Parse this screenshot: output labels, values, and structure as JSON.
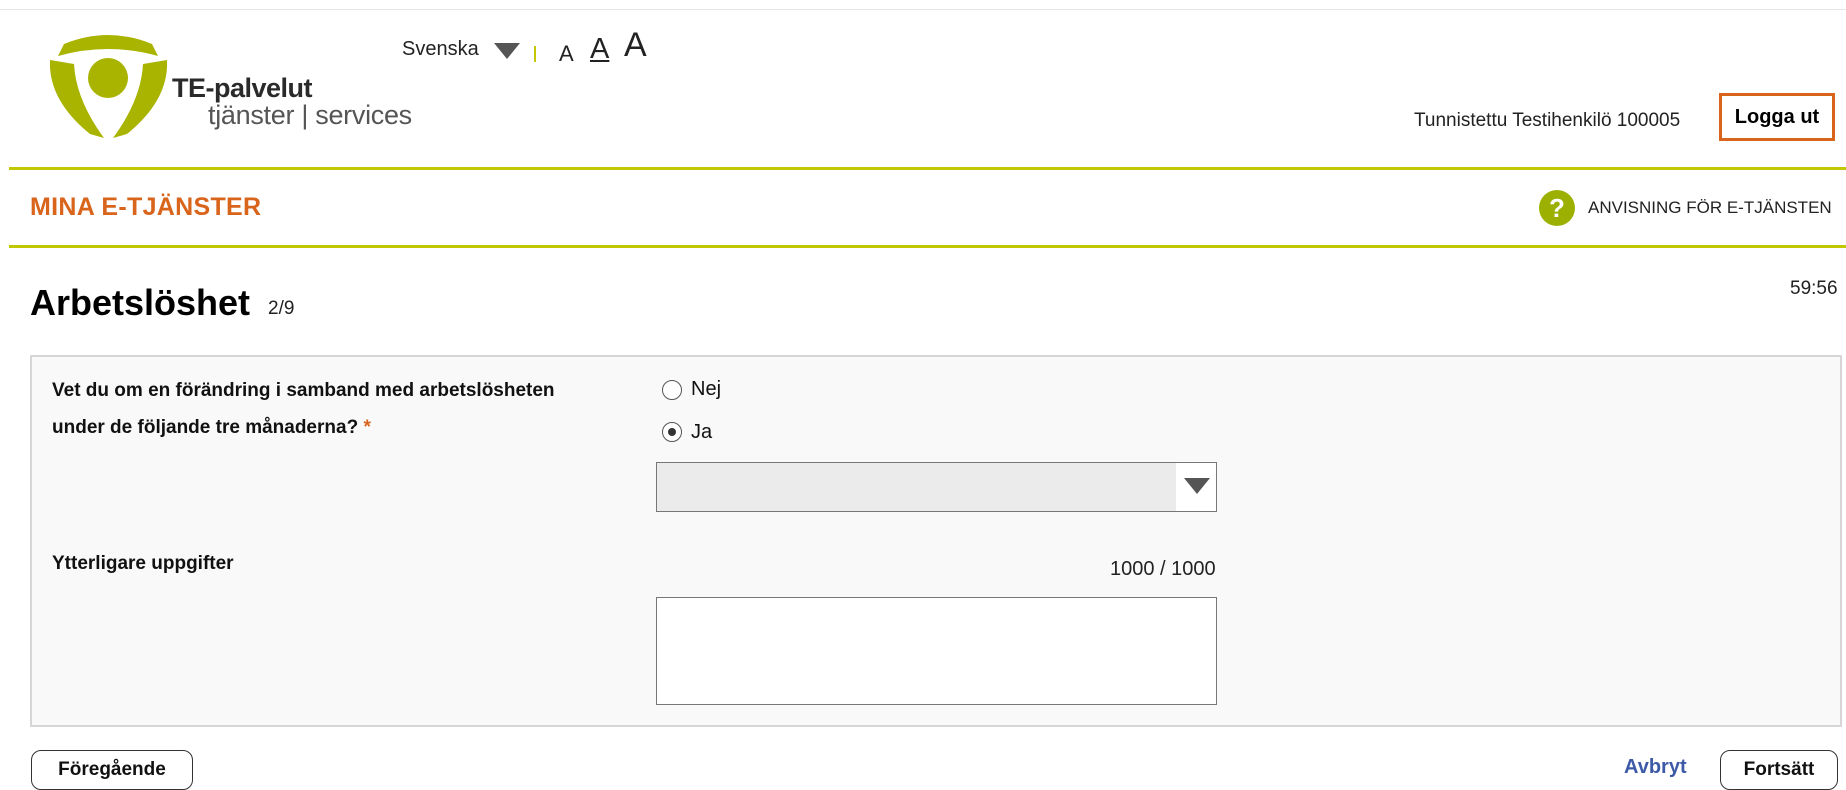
{
  "header": {
    "logo": {
      "name": "TE-palvelut",
      "tagline": "tjänster | services"
    },
    "language": {
      "selected": "Svenska"
    },
    "text_size": {
      "small": "A",
      "medium": "A",
      "large": "A"
    },
    "user": {
      "name": "Tunnistettu Testihenkilö 100005"
    },
    "logout_label": "Logga ut"
  },
  "service_bar": {
    "title": "MINA E-TJÄNSTER",
    "help_icon": "?",
    "help_link": "ANVISNING FÖR E-TJÄNSTEN"
  },
  "page": {
    "title": "Arbetslöshet",
    "step": "2/9",
    "timer": "59:56"
  },
  "form": {
    "question": {
      "label": "Vet du om en förändring i samband med arbetslösheten under de följande tre månaderna?",
      "required_mark": "*",
      "options": [
        {
          "label": "Nej",
          "selected": false
        },
        {
          "label": "Ja",
          "selected": true
        }
      ],
      "select_value": ""
    },
    "extra": {
      "label": "Ytterligare uppgifter",
      "counter": "1000 / 1000",
      "value": ""
    }
  },
  "footer": {
    "prev_label": "Föregående",
    "cancel_label": "Avbryt",
    "next_label": "Fortsätt"
  },
  "colors": {
    "accent_orange": "#d9641c",
    "brand_green": "#c2c800",
    "logo_green": "#a9b400",
    "link_blue": "#3c5aa8"
  },
  "icons": {
    "language_dropdown": "chevron-down-icon",
    "help": "help-icon",
    "select_dropdown": "chevron-down-icon"
  }
}
